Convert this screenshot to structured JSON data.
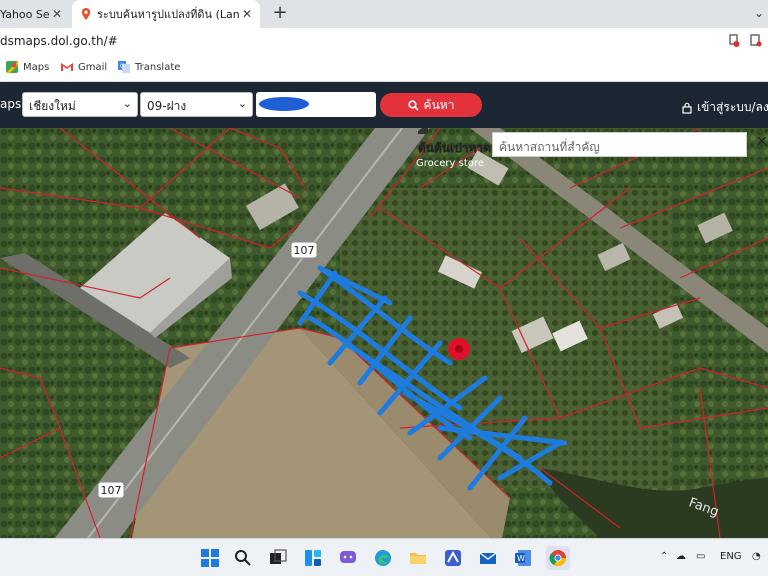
{
  "browser": {
    "tabs": [
      {
        "label": "Yahoo Sear",
        "active": false
      },
      {
        "label": "ระบบค้นหารูปแปลงที่ดิน (LandsMaps",
        "active": true
      }
    ],
    "new_tab_symbol": "+",
    "url": "dsmaps.dol.go.th/#",
    "bookmarks": [
      {
        "label": "Maps",
        "icon": "maps-icon"
      },
      {
        "label": "Gmail",
        "icon": "gmail-icon"
      },
      {
        "label": "Translate",
        "icon": "translate-icon"
      }
    ]
  },
  "app": {
    "brand": "aps",
    "province": "เชียงใหม่",
    "district": "09-ฝาง",
    "parcel_value": "",
    "search_label": "ค้นหา",
    "login_label": "เข้าสู่ระบบ/ลง",
    "accent": "#e3323b",
    "nav_bg": "#1d2733"
  },
  "map": {
    "place_search_placeholder": "ค้นหาสถานที่สำคัญ",
    "close_symbol": "✕",
    "poi_name": "ต้นต้นเปาหาด",
    "poi_category": "Grocery store",
    "route_shield_1": "107",
    "route_shield_2": "107",
    "river_label": "Fang",
    "pin_color": "#e0102a",
    "hatch_color": "#1e7be0"
  },
  "taskbar": {
    "language": "ENG",
    "apps": [
      "start-icon",
      "search-icon",
      "task-view-icon",
      "widgets-icon",
      "chat-icon",
      "edge-icon",
      "file-explorer-icon",
      "vpn-icon",
      "mail-icon",
      "word-icon",
      "chrome-icon"
    ]
  }
}
